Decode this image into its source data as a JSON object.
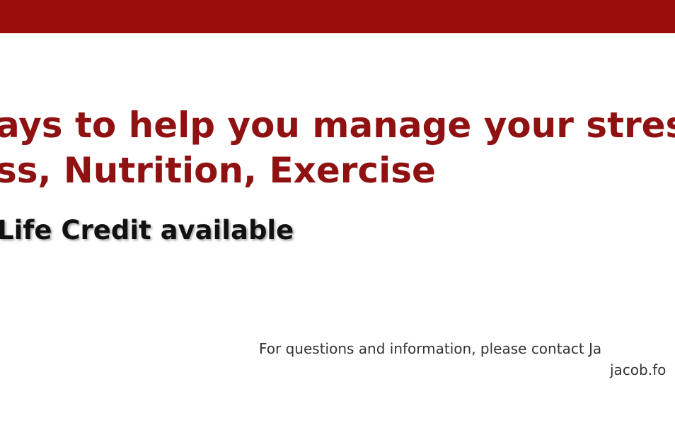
{
  "banner": {
    "color": "#980c0c"
  },
  "headline": {
    "line1": "ays to help you manage your stress:",
    "line2": "ss, Nutrition, Exercise",
    "color": "#8f1111"
  },
  "credit": {
    "text": "Life Credit available"
  },
  "contact": {
    "line1": "For questions and information, please contact Ja",
    "line2": "jacob.fo"
  }
}
